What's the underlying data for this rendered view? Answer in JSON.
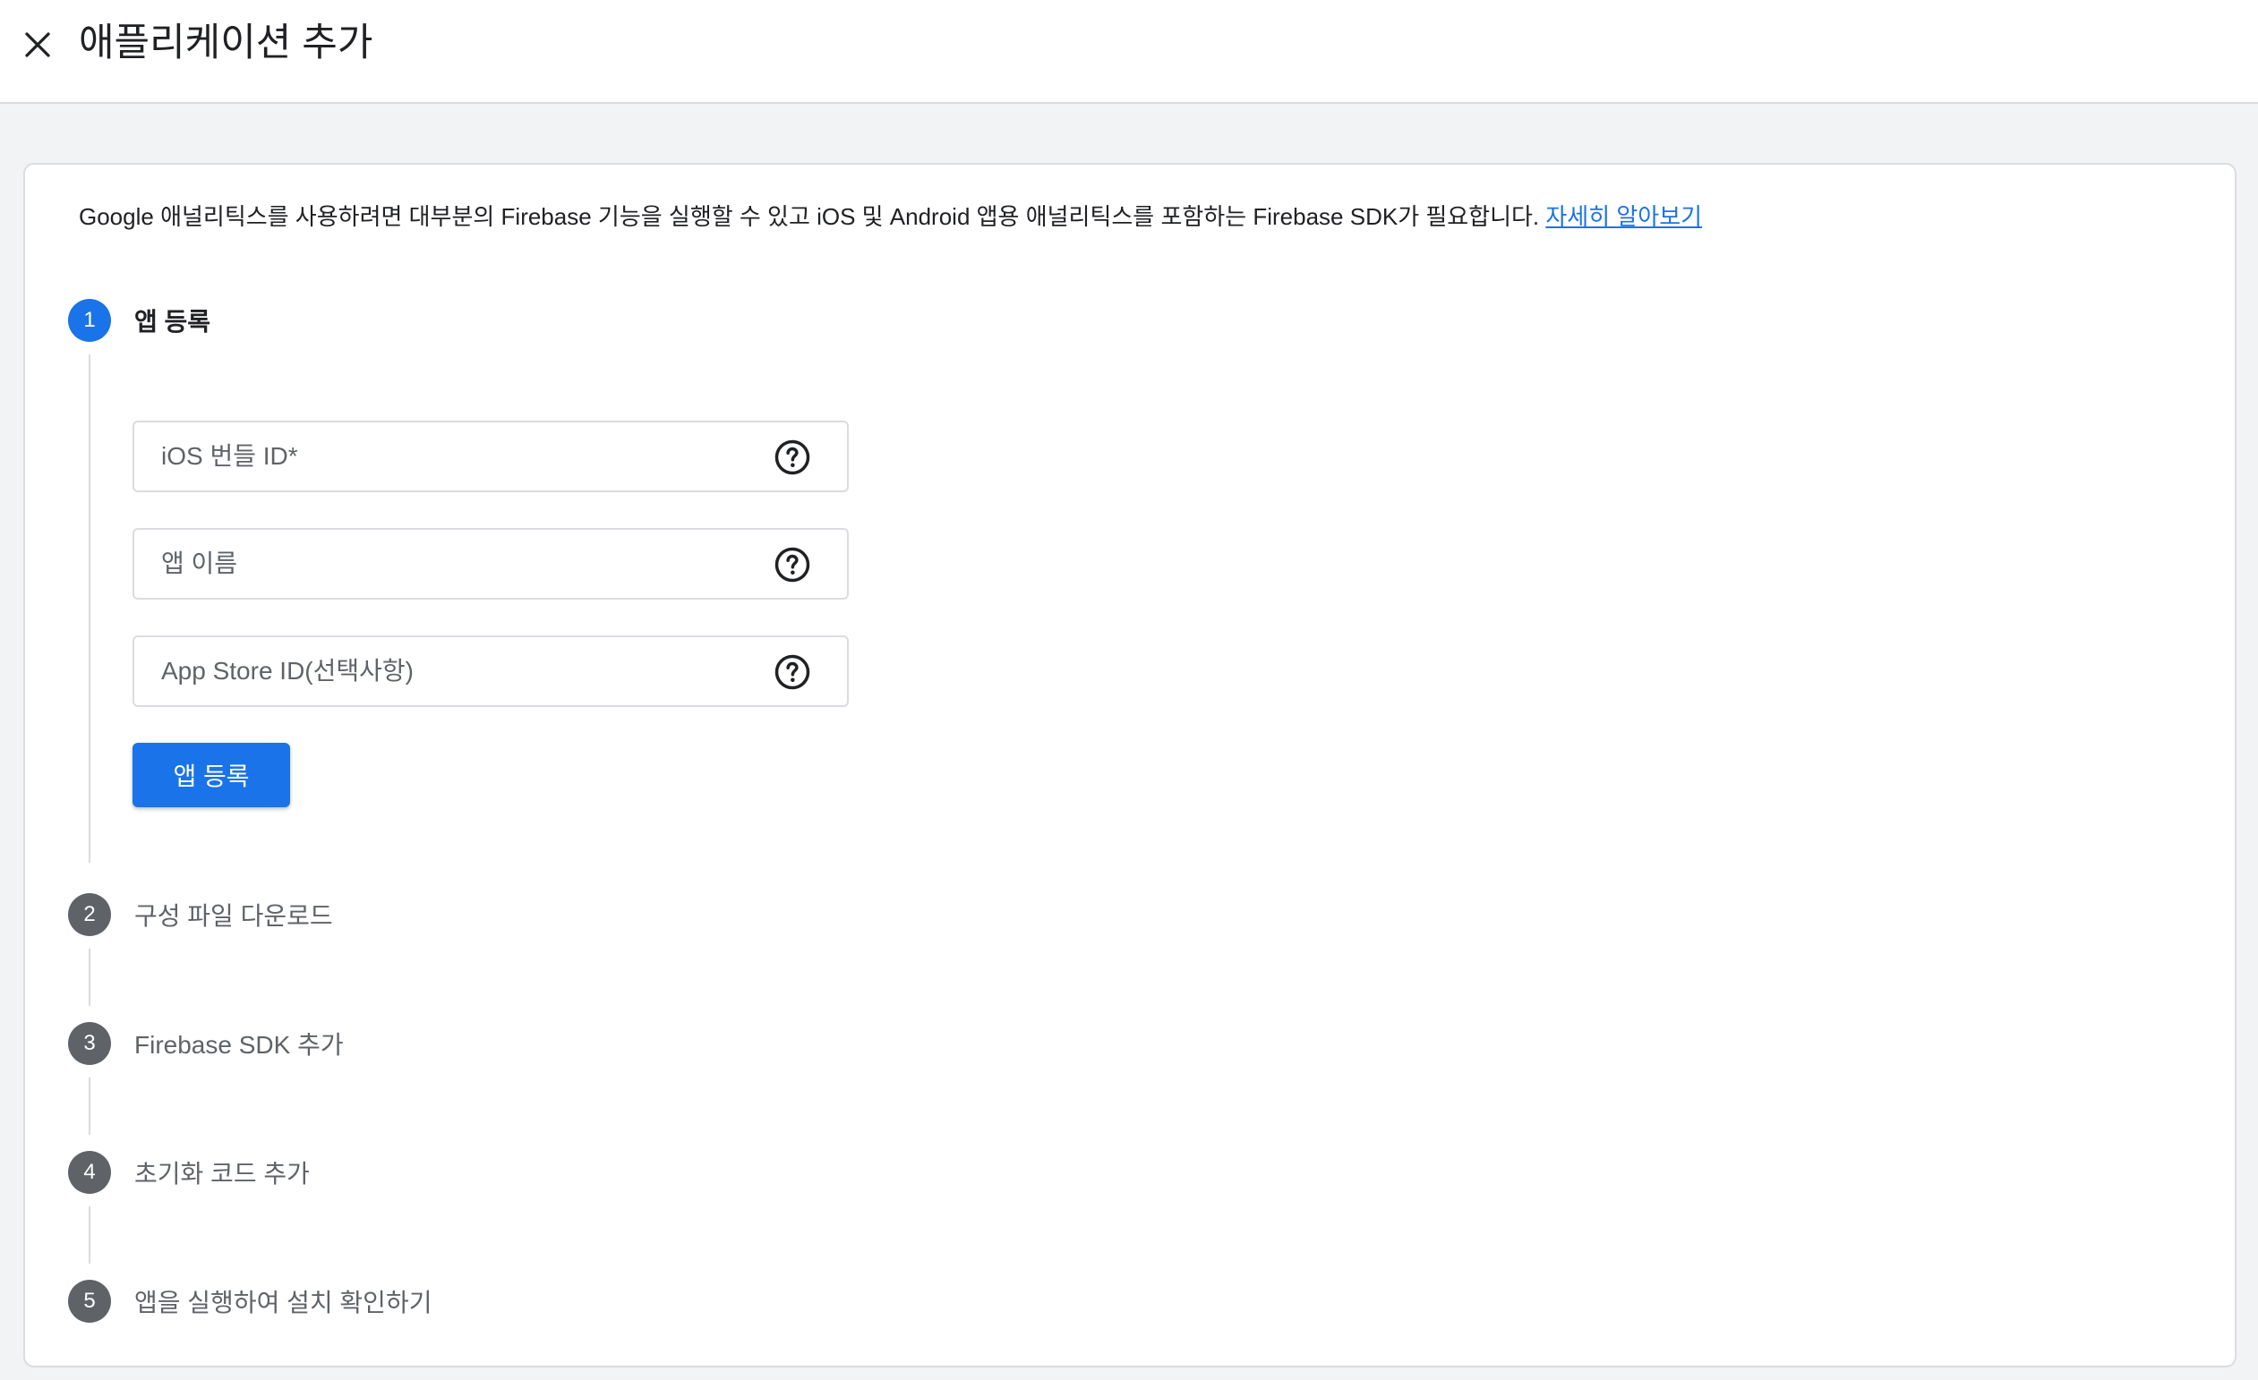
{
  "header": {
    "title": "애플리케이션 추가",
    "close_icon": "close-icon"
  },
  "intro": {
    "text": "Google 애널리틱스를 사용하려면 대부분의 Firebase 기능을 실행할 수 있고 iOS 및 Android 앱용 애널리틱스를 포함하는 Firebase SDK가 필요합니다. ",
    "link": "자세히 알아보기"
  },
  "steps": [
    {
      "number": "1",
      "label": "앱 등록",
      "active": true
    },
    {
      "number": "2",
      "label": "구성 파일 다운로드",
      "active": false
    },
    {
      "number": "3",
      "label": "Firebase SDK 추가",
      "active": false
    },
    {
      "number": "4",
      "label": "초기화 코드 추가",
      "active": false
    },
    {
      "number": "5",
      "label": "앱을 실행하여 설치 확인하기",
      "active": false
    }
  ],
  "form": {
    "fields": [
      {
        "label": "iOS 번들 ID*",
        "value": "",
        "help_icon": "help-circle-icon"
      },
      {
        "label": "앱 이름",
        "value": "",
        "help_icon": "help-circle-icon"
      },
      {
        "label": "App Store ID(선택사항)",
        "value": "",
        "help_icon": "help-circle-icon"
      }
    ],
    "submit_label": "앱 등록"
  },
  "colors": {
    "accent": "#1a73e8",
    "inactive_step": "#5f6368",
    "background": "#f1f3f4"
  }
}
